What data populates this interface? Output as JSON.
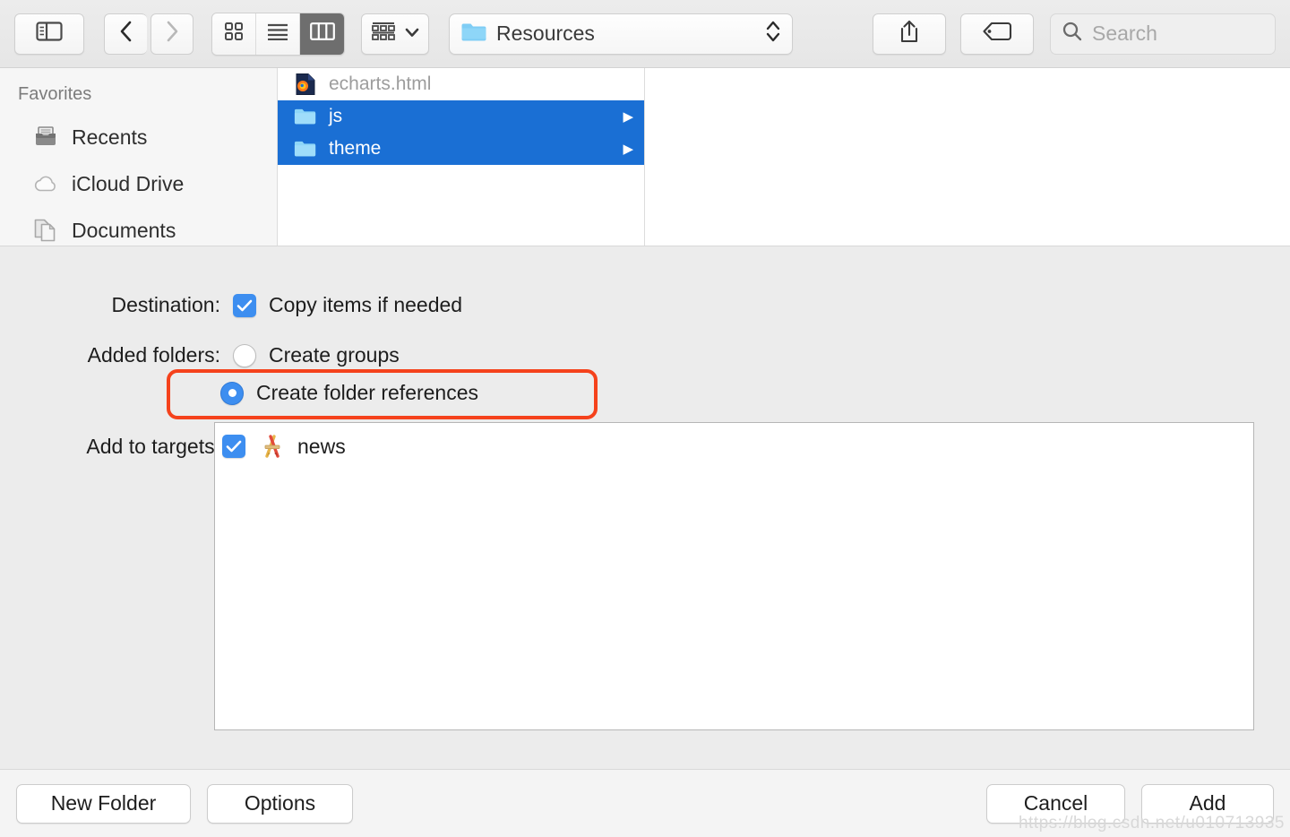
{
  "toolbar": {
    "sidebar_toggle": "sidebar-toggle",
    "back": "back",
    "forward": "forward",
    "view_icon": "icon-view",
    "view_list": "list-view",
    "view_column": "column-view",
    "group_by": "group-by",
    "path_label": "Resources",
    "share": "share",
    "tags": "tags",
    "search_placeholder": "Search"
  },
  "sidebar": {
    "header": "Favorites",
    "items": [
      {
        "label": "Recents",
        "icon": "recents-icon"
      },
      {
        "label": "iCloud Drive",
        "icon": "icloud-icon"
      },
      {
        "label": "Documents",
        "icon": "documents-icon"
      }
    ]
  },
  "browser": {
    "files": [
      {
        "name": "echarts.html",
        "icon": "html-file-icon",
        "selected": false,
        "dimmed": true,
        "has_children": false
      },
      {
        "name": "js",
        "icon": "folder-icon",
        "selected": true,
        "dimmed": false,
        "has_children": true
      },
      {
        "name": "theme",
        "icon": "folder-icon",
        "selected": true,
        "dimmed": false,
        "has_children": true
      }
    ]
  },
  "options": {
    "destination_label": "Destination:",
    "copy_items_label": "Copy items if needed",
    "copy_items_checked": true,
    "added_folders_label": "Added folders:",
    "create_groups_label": "Create groups",
    "create_groups_selected": false,
    "create_folder_refs_label": "Create folder references",
    "create_folder_refs_selected": true,
    "highlight_color": "#f5421c",
    "add_to_targets_label": "Add to targets:",
    "targets": [
      {
        "name": "news",
        "checked": true,
        "icon": "xcode-app-icon"
      }
    ]
  },
  "bottom": {
    "new_folder": "New Folder",
    "options": "Options",
    "cancel": "Cancel",
    "add": "Add"
  },
  "watermark": "https://blog.csdn.net/u010713935"
}
